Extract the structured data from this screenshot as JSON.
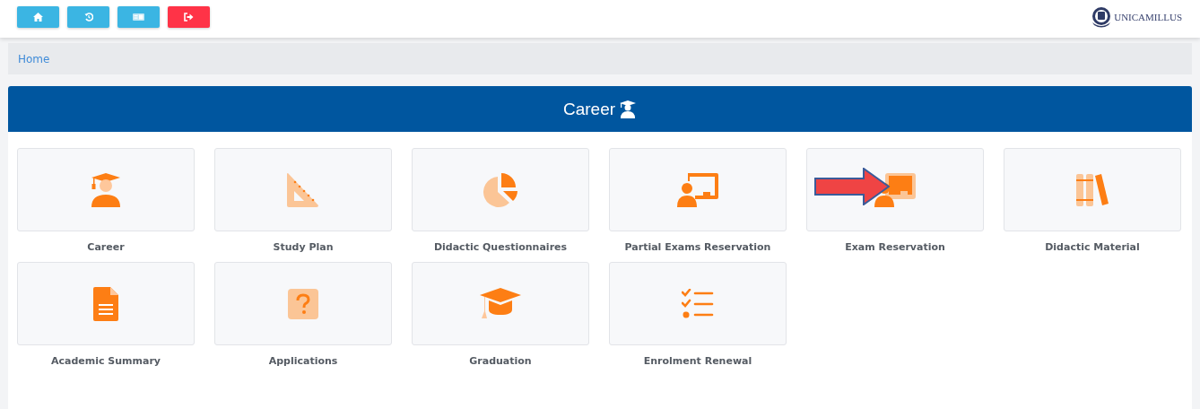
{
  "toolbar": [
    {
      "kind": "home",
      "color": "#3bb5e3"
    },
    {
      "kind": "history",
      "color": "#3bb5e3"
    },
    {
      "kind": "card",
      "color": "#3bb5e3"
    },
    {
      "kind": "logout",
      "color": "#ff3347"
    }
  ],
  "logo": {
    "text": "UNICAMILLUS"
  },
  "breadcrumb": [
    {
      "label": "Home"
    }
  ],
  "panel": {
    "title": "Career"
  },
  "tiles": [
    {
      "label": "Career",
      "kind": "graduate",
      "arrow": false
    },
    {
      "label": "Study Plan",
      "kind": "set-square",
      "arrow": false
    },
    {
      "label": "Didactic Questionnaires",
      "kind": "pie",
      "arrow": false
    },
    {
      "label": "Partial Exams Reservation",
      "kind": "presenter",
      "arrow": false
    },
    {
      "label": "Exam Reservation",
      "kind": "presenter-board",
      "arrow": true
    },
    {
      "label": "Didactic Material",
      "kind": "books",
      "arrow": false
    },
    {
      "label": "Academic Summary",
      "kind": "document",
      "arrow": false
    },
    {
      "label": "Applications",
      "kind": "question",
      "arrow": false
    },
    {
      "label": "Graduation",
      "kind": "cap",
      "arrow": false
    },
    {
      "label": "Enrolment Renewal",
      "kind": "checklist",
      "arrow": false
    }
  ]
}
